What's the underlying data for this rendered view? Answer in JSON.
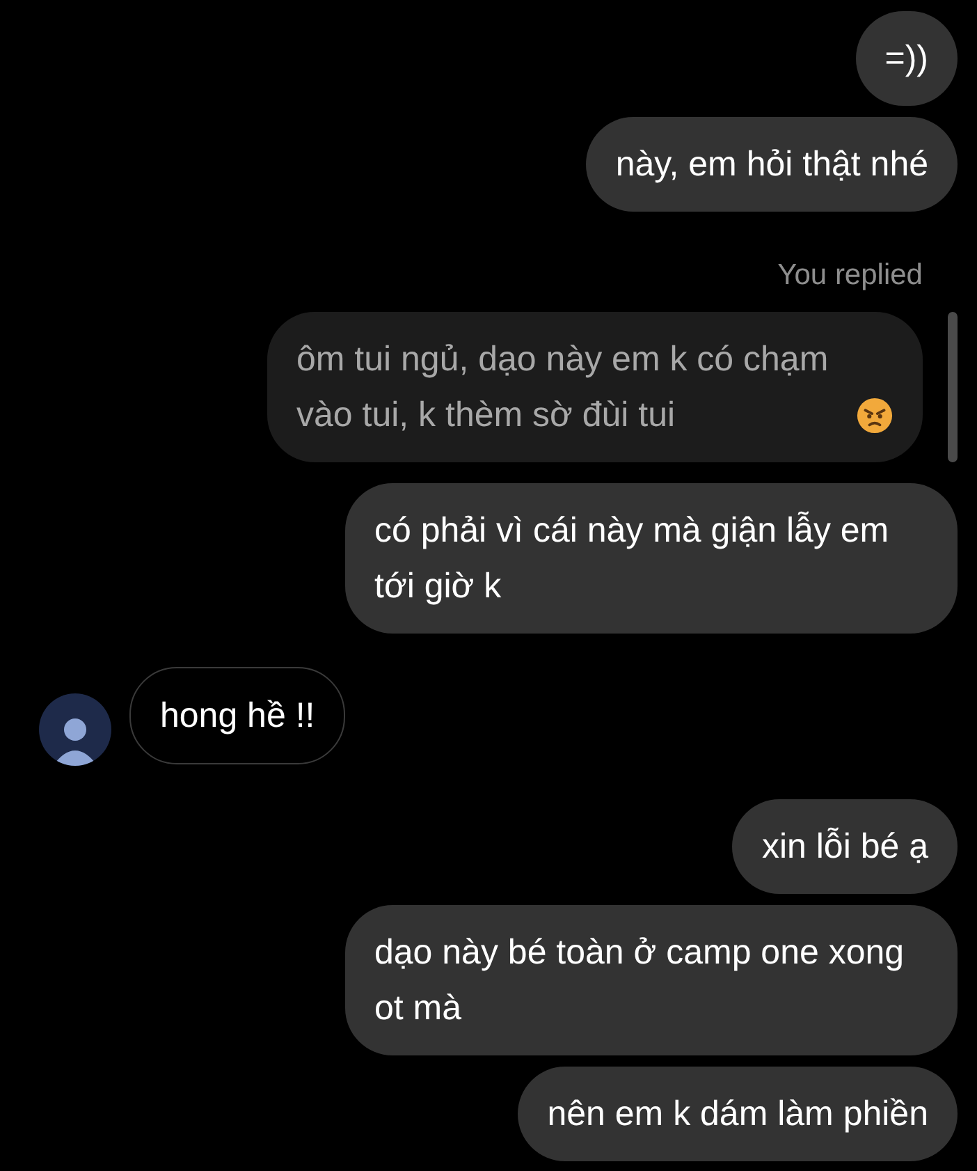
{
  "messages": [
    {
      "kind": "sent",
      "text": "=))"
    },
    {
      "kind": "sent",
      "text": "này, em hỏi thật nhé"
    },
    {
      "kind": "reply_label",
      "text": "You replied"
    },
    {
      "kind": "quoted",
      "text": "ôm tui ngủ, dạo này em k có chạm vào tui, k thèm sờ đùi tui",
      "angry_emoji": true
    },
    {
      "kind": "sent",
      "text": "có phải vì cái này mà giận lẫy em tới giờ k"
    },
    {
      "kind": "received",
      "text": "hong hề !!"
    },
    {
      "kind": "sent",
      "text": "xin lỗi bé ạ"
    },
    {
      "kind": "sent",
      "text": "dạo này bé toàn ở camp one xong ot mà"
    },
    {
      "kind": "sent",
      "text": "nên em k dám làm phiền"
    }
  ]
}
